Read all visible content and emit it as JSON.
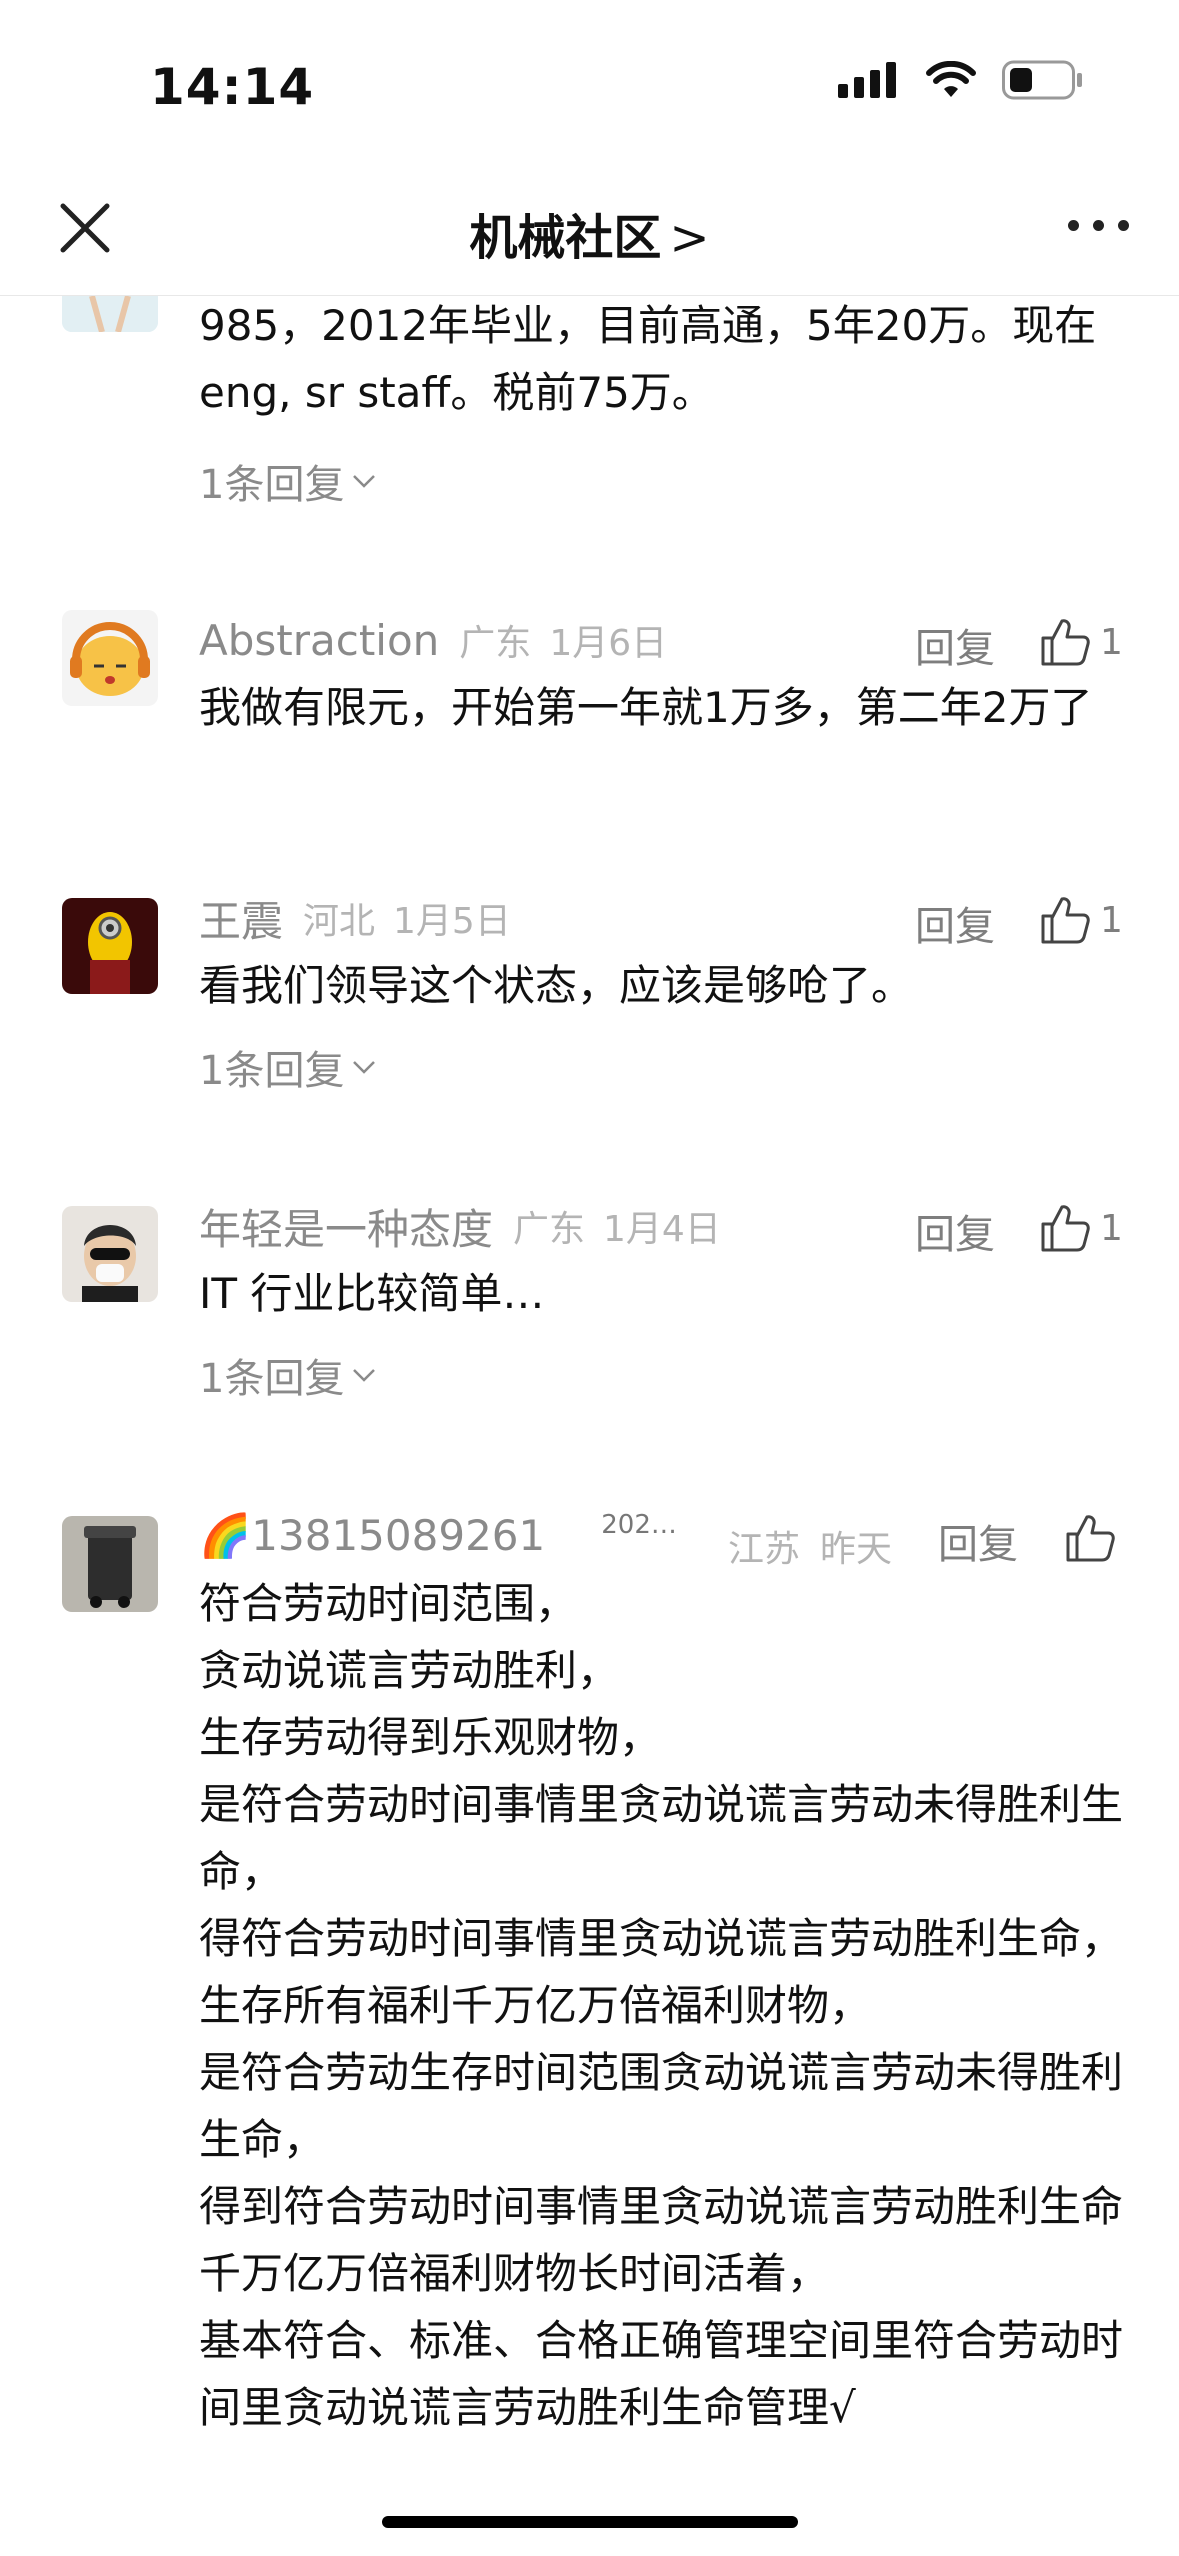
{
  "status": {
    "time": "14:14"
  },
  "nav": {
    "title": "机械社区",
    "chevron": ">"
  },
  "top_comment": {
    "body": "985，2012年毕业，目前高通，5年20万。现在eng, sr staff。税前75万。",
    "replies": "1条回复"
  },
  "comments": [
    {
      "author": "Abstraction",
      "location": "广东",
      "date": "1月6日",
      "reply": "回复",
      "likes": "1",
      "body": "我做有限元，开始第一年就1万多，第二年2万了"
    },
    {
      "author": "王震",
      "location": "河北",
      "date": "1月5日",
      "reply": "回复",
      "likes": "1",
      "body": "看我们领导这个状态，应该是够呛了。",
      "replies": "1条回复"
    },
    {
      "author": "年轻是一种态度",
      "location": "广东",
      "date": "1月4日",
      "reply": "回复",
      "likes": "1",
      "body": "IT 行业比较简单…",
      "replies": "1条回复"
    },
    {
      "author": "🌈13815089261",
      "author_suffix": "202…",
      "location": "江苏",
      "date": "昨天",
      "reply": "回复",
      "body": "符合劳动时间范围，\n贪动说谎言劳动胜利，\n生存劳动得到乐观财物，\n是符合劳动时间事情里贪动说谎言劳动未得胜利生命，\n得符合劳动时间事情里贪动说谎言劳动胜利生命，\n生存所有福利千万亿万倍福利财物，\n是符合劳动生存时间范围贪动说谎言劳动未得胜利生命，\n得到符合劳动时间事情里贪动说谎言劳动胜利生命千万亿万倍福利财物长时间活着，\n基本符合、标准、合格正确管理空间里符合劳动时间里贪动说谎言劳动胜利生命管理√"
    }
  ],
  "icons": {
    "close": "close-icon",
    "more": "more-icon",
    "like": "thumbs-up-icon",
    "expand": "chevron-down-icon"
  }
}
